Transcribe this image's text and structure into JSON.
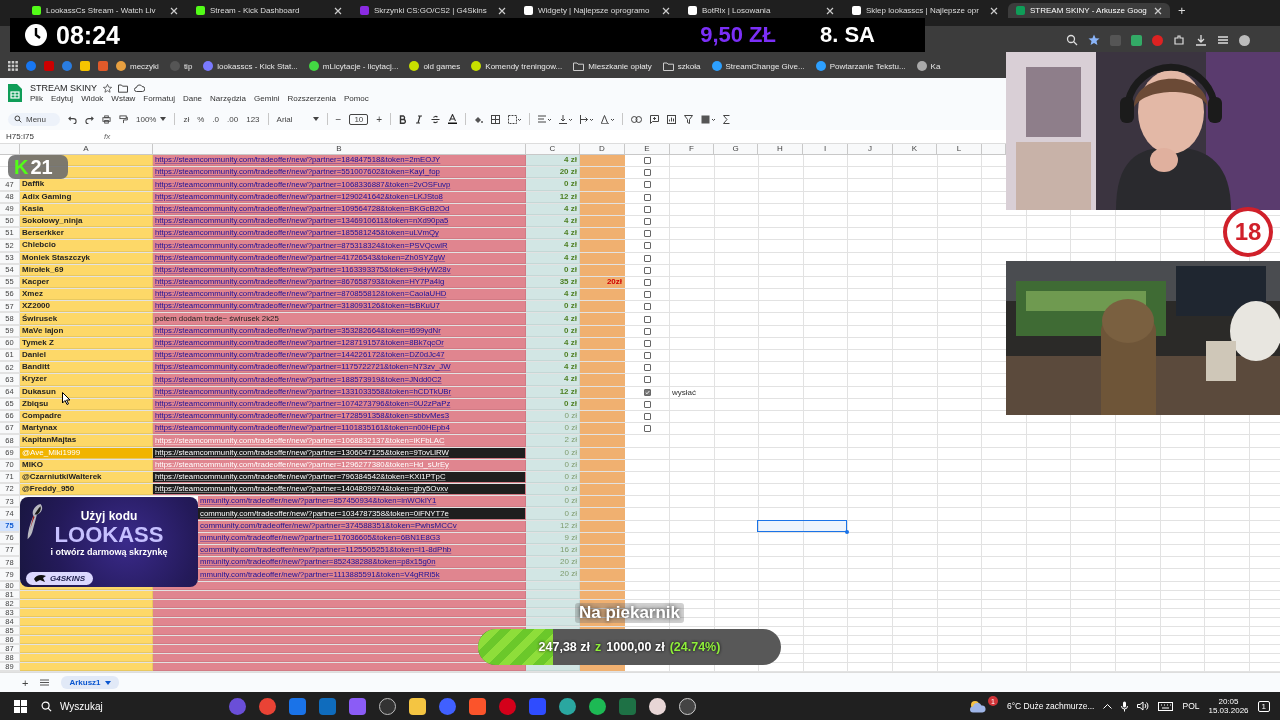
{
  "browser": {
    "tabs": [
      {
        "title": "LookassCs Stream - Watch Liv",
        "selected": false
      },
      {
        "title": "Stream - Kick Dashboard",
        "selected": false
      },
      {
        "title": "Skrzynki CS:GO/CS2 | G4Skins",
        "selected": false
      },
      {
        "title": "Widgety | Najlepsze oprogramo",
        "selected": false
      },
      {
        "title": "BotRix | Losowania",
        "selected": false
      },
      {
        "title": "Sklep lookasscs | Najlepsze opr",
        "selected": false
      },
      {
        "title": "STREAM SKINY - Arkusze Goog",
        "selected": true
      }
    ],
    "new_tab": "+",
    "bookmarks": [
      {
        "label": "meczyki"
      },
      {
        "label": "tip"
      },
      {
        "label": "lookasscs - Kick Stat..."
      },
      {
        "label": "mLicytacje - licytacj..."
      },
      {
        "label": "old games"
      },
      {
        "label": "Komendy treningow..."
      },
      {
        "label": "Mieszkanie opłaty",
        "kind": "folder"
      },
      {
        "label": "szkoła",
        "kind": "folder"
      },
      {
        "label": "StreamChange Give..."
      },
      {
        "label": "Powtarzanie Tekstu..."
      },
      {
        "label": "Ka"
      }
    ]
  },
  "stream_overlay": {
    "clock": "08:24",
    "donation": "9,50 ZŁ",
    "donor": "8. SA",
    "kick_badge": {
      "letter": "K",
      "count": "21"
    },
    "age_badge": "18",
    "promo": {
      "line1": "Użyj kodu",
      "code": "LOOKASS",
      "line2": "i otwórz darmową skrzynkę",
      "brand": "G4SKINS"
    },
    "goal": {
      "title": "Na piekarnik",
      "current": "247,38 zł",
      "separator": "z",
      "target": "1000,00 zł",
      "percent": "(24.74%)",
      "level": 0.2474
    }
  },
  "sheet": {
    "title": "STREAM SKINY",
    "menu": [
      "Plik",
      "Edytuj",
      "Widok",
      "Wstaw",
      "Formatuj",
      "Dane",
      "Narzędzia",
      "Gemini",
      "Rozszerzenia",
      "Pomoc"
    ],
    "toolbar": {
      "search": "Menu",
      "zoom": "100%",
      "currency": "zł",
      "percent": "%",
      "decrease_decimals": ".0",
      "increase_decimals": ".00",
      "format": "123",
      "font": "Arial",
      "font_minus": "−",
      "font_size": "10",
      "font_plus": "+"
    },
    "name_box": "H75:I75",
    "fx": "fx",
    "columns": [
      "A",
      "B",
      "C",
      "D",
      "E",
      "F",
      "G",
      "H",
      "I",
      "J",
      "K",
      "L"
    ],
    "rows": [
      {
        "link": "https://steamcommunity.com/tradeoffer/new/?partner=184847518&token=2mEOJY",
        "kind": "link",
        "covered": false,
        "amount": "4 zł",
        "dim": false,
        "checkbox": {
          "checked": false
        }
      },
      {
        "link": "https://steamcommunity.com/tradeoffer/new/?partner=551007602&token=KayI_fop",
        "kind": "link",
        "covered": false,
        "amount": "20 zł",
        "dim": false,
        "checkbox": {
          "checked": false
        }
      },
      {
        "num": "47",
        "name": "Daffik",
        "link": "https://steamcommunity.com/tradeoffer/new/?partner=1068336887&token=2vOSFuvp",
        "kind": "link",
        "covered": false,
        "amount": "0 zł",
        "dim": false,
        "checkbox": {
          "checked": false
        },
        "selected": false
      },
      {
        "num": "48",
        "name": "Adix Gaming",
        "link": "https://steamcommunity.com/tradeoffer/new/?partner=1290241642&token=LKJSto8",
        "kind": "link",
        "covered": false,
        "amount": "12 zł",
        "dim": false,
        "checkbox": {
          "checked": false
        },
        "selected": false
      },
      {
        "num": "49",
        "name": "Kasia",
        "link": "https://steamcommunity.com/tradeoffer/new/?partner=109564728&token=BKGcB2Od",
        "kind": "link",
        "covered": false,
        "amount": "4 zł",
        "dim": false,
        "checkbox": {
          "checked": false
        },
        "selected": false
      },
      {
        "num": "50",
        "name": "Sokołowy_ninja",
        "link": "https://steamcommunity.com/tradeoffer/new/?partner=1346910611&token=nXd90pa5",
        "kind": "link",
        "covered": false,
        "amount": "4 zł",
        "dim": false,
        "checkbox": {
          "checked": false
        },
        "selected": false
      },
      {
        "num": "51",
        "name": "Berserkker",
        "link": "https://steamcommunity.com/tradeoffer/new/?partner=185581245&token=uLVmQy",
        "kind": "link",
        "covered": false,
        "amount": "4 zł",
        "dim": false,
        "checkbox": {
          "checked": false
        },
        "selected": false
      },
      {
        "num": "52",
        "name": "Chlebcio",
        "link": "https://steamcommunity.com/tradeoffer/new/?partner=875318324&token=PSVQcwlR",
        "kind": "link",
        "covered": false,
        "amount": "4 zł",
        "dim": false,
        "checkbox": {
          "checked": false
        },
        "selected": false
      },
      {
        "num": "53",
        "name": "Moniek Staszczyk",
        "link": "https://steamcommunity.com/tradeoffer/new/?partner=41726543&token=Zh0SYZgW",
        "kind": "link",
        "covered": false,
        "amount": "4 zł",
        "dim": false,
        "checkbox": {
          "checked": false
        },
        "selected": false
      },
      {
        "num": "54",
        "name": "Mirołek_69",
        "link": "https://steamcommunity.com/tradeoffer/new/?partner=1163393375&token=9xHyW28v",
        "kind": "link",
        "covered": false,
        "amount": "0 zł",
        "dim": false,
        "checkbox": {
          "checked": false
        },
        "selected": false
      },
      {
        "num": "55",
        "name": "Kacper",
        "link": "https://steamcommunity.com/tradeoffer/new/?partner=867658793&token=HY7Pa4ig",
        "kind": "link",
        "covered": false,
        "amount": "35 zł",
        "dim": false,
        "note": "20zł",
        "checkbox": {
          "checked": false
        },
        "selected": false
      },
      {
        "num": "56",
        "name": "Xmez",
        "link": "https://steamcommunity.com/tradeoffer/new/?partner=870855812&token=CaoiaUHD",
        "kind": "link",
        "covered": false,
        "amount": "4 zł",
        "dim": false,
        "checkbox": {
          "checked": false
        },
        "selected": false
      },
      {
        "num": "57",
        "name": "XZ2000",
        "link": "https://steamcommunity.com/tradeoffer/new/?partner=318093126&token=tsBKuU7",
        "kind": "link",
        "covered": false,
        "amount": "0 zł",
        "dim": false,
        "checkbox": {
          "checked": false
        },
        "selected": false
      },
      {
        "num": "58",
        "name": "Świrusek",
        "link": "potem dodam trade~ świrusek 2k25",
        "kind": "text",
        "covered": false,
        "amount": "4 zł",
        "dim": false,
        "checkbox": {
          "checked": false
        },
        "selected": false
      },
      {
        "num": "59",
        "name": "MaVe lajon",
        "link": "https://steamcommunity.com/tradeoffer/new/?partner=353282664&token=t699ydNr",
        "kind": "link",
        "covered": false,
        "amount": "0 zł",
        "dim": false,
        "checkbox": {
          "checked": false
        },
        "selected": false
      },
      {
        "num": "60",
        "name": "Tymek Z",
        "link": "https://steamcommunity.com/tradeoffer/new/?partner=128719157&token=8Bk7qcOr",
        "kind": "link",
        "covered": false,
        "amount": "4 zł",
        "dim": false,
        "checkbox": {
          "checked": false
        },
        "selected": false
      },
      {
        "num": "61",
        "name": "Daniel",
        "link": "https://steamcommunity.com/tradeoffer/new/?partner=144226172&token=DZ0dJc47",
        "kind": "link",
        "covered": false,
        "amount": "0 zł",
        "dim": false,
        "checkbox": {
          "checked": false
        },
        "selected": false
      },
      {
        "num": "62",
        "name": "Banditt",
        "link": "https://steamcommunity.com/tradeoffer/new/?partner=1175722721&token=N73zv_JW",
        "kind": "link",
        "covered": false,
        "amount": "4 zł",
        "dim": false,
        "checkbox": {
          "checked": false
        },
        "selected": false
      },
      {
        "num": "63",
        "name": "Kryzer",
        "link": "https://steamcommunity.com/tradeoffer/new/?partner=188573919&token=JNdd0C2",
        "kind": "link",
        "covered": false,
        "amount": "4 zł",
        "dim": false,
        "checkbox": {
          "checked": false
        },
        "selected": false
      },
      {
        "num": "64",
        "name": "Dukasun",
        "link": "https://steamcommunity.com/tradeoffer/new/?partner=1331033558&token=hCDTkUBr",
        "kind": "link",
        "covered": false,
        "amount": "12 zł",
        "dim": false,
        "checkbox": {
          "checked": true
        },
        "status": "wysłać",
        "selected": false
      },
      {
        "num": "65",
        "name": "Zbiqsu",
        "link": "https://steamcommunity.com/tradeoffer/new/?partner=1074273796&token=0U2zPaPz",
        "kind": "link",
        "covered": false,
        "amount": "0 zł",
        "dim": false,
        "checkbox": {
          "checked": false
        },
        "selected": false
      },
      {
        "num": "66",
        "name": "Compadre",
        "link": "https://steamcommunity.com/tradeoffer/new/?partner=1728591358&token=sbbvMes3",
        "kind": "link",
        "covered": false,
        "amount": "0 zł",
        "dim": true,
        "checkbox": {
          "checked": false
        },
        "selected": false
      },
      {
        "num": "67",
        "name": "Martynax",
        "link": "https://steamcommunity.com/tradeoffer/new/?partner=1101835161&token=n00HEpb4",
        "kind": "link",
        "covered": false,
        "amount": "0 zł",
        "dim": true,
        "checkbox": {
          "checked": false
        },
        "selected": false
      },
      {
        "num": "68",
        "name": "KapitanMajtas",
        "link": "https://steamcommunity.com/tradeoffer/new/?partner=1068832137&token=iKFbLAC",
        "kind": "faded",
        "covered": false,
        "amount": "2 zł",
        "dim": true,
        "selected": false
      },
      {
        "num": "69",
        "name": "@Ave_Miki1999",
        "link": "https://steamcommunity.com/tradeoffer/new/?partner=1306047125&token=9TovLlRW",
        "kind": "dark-row",
        "covered": false,
        "amount": "0 zł",
        "dim": true,
        "selected": false
      },
      {
        "num": "70",
        "name": "MIKO",
        "link": "https://steamcommunity.com/tradeoffer/new/?partner=1296277380&token=Hd_sUrEy",
        "kind": "faded",
        "covered": false,
        "amount": "0 zł",
        "dim": true,
        "selected": false
      },
      {
        "num": "71",
        "name": "@CzarniutkiWalterek",
        "link": "https://steamcommunity.com/tradeoffer/new/?partner=796384542&token=KXl1PTpC",
        "kind": "dark",
        "covered": false,
        "amount": "0 zł",
        "dim": true,
        "selected": false
      },
      {
        "num": "72",
        "name": "@Freddy_950",
        "link": "https://steamcommunity.com/tradeoffer/new/?partner=1404809974&token=gby5Ovxv",
        "kind": "dark",
        "covered": false,
        "amount": "0 zł",
        "dim": true,
        "selected": false
      },
      {
        "num": "73",
        "link": "mmunity.com/tradeoffer/new/?partner=857450934&token=inWOkIY1",
        "kind": "link",
        "covered": true,
        "amount": "0 zł",
        "dim": true,
        "selected": false
      },
      {
        "num": "74",
        "link": "community.com/tradeoffer/new/?partner=1034787358&token=0iFNYT7e",
        "kind": "dark",
        "covered": true,
        "amount": "0 zł",
        "dim": true,
        "selected": false
      },
      {
        "num": "75",
        "link": "community.com/tradeoffer/new/?partner=374588351&token=PwhsMCCv",
        "kind": "bold",
        "covered": true,
        "amount": "12 zł",
        "dim": true,
        "selected": true
      },
      {
        "num": "76",
        "link": "mmunity.com/tradeoffer/new/?partner=117036605&token=6BN1E8G3",
        "kind": "link",
        "covered": true,
        "amount": "9 zł",
        "dim": true,
        "selected": false
      },
      {
        "num": "77",
        "link": "community.com/tradeoffer/new/?partner=1125505251&token=I1-8dPhb",
        "kind": "bold",
        "covered": true,
        "amount": "16 zł",
        "dim": true,
        "selected": false
      },
      {
        "num": "78",
        "link": "mmunity.com/tradeoffer/new/?partner=852438288&token=p8x15g0n",
        "kind": "link",
        "covered": true,
        "amount": "20 zł",
        "dim": true,
        "selected": false
      },
      {
        "num": "79",
        "link": "mmunity.com/tradeoffer/new/?partner=1113885591&token=V4gRRi5k",
        "kind": "link",
        "covered": true,
        "amount": "20 zł",
        "dim": true,
        "selected": false
      },
      {
        "num": "80",
        "selected": false
      },
      {
        "num": "81",
        "selected": false
      },
      {
        "num": "82",
        "selected": false
      },
      {
        "num": "83",
        "selected": false
      },
      {
        "num": "84",
        "selected": false
      },
      {
        "num": "85",
        "selected": false
      },
      {
        "num": "86",
        "selected": false
      },
      {
        "num": "87",
        "selected": false
      },
      {
        "num": "88",
        "selected": false
      },
      {
        "num": "89",
        "selected": false
      }
    ],
    "sheet_tabs": {
      "add": "+",
      "tabs": [
        {
          "label": "Arkusz1",
          "selected": true
        }
      ]
    }
  },
  "taskbar": {
    "search": "Wyszukaj",
    "weather": "6°C Duże zachmurze...",
    "weather_badge": "1",
    "language": "POL",
    "time": "20:05",
    "date": "15.03.2026",
    "notifications": "1"
  }
}
